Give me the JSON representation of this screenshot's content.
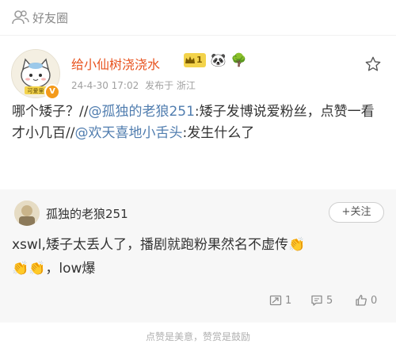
{
  "header": {
    "group_label": "好友圈",
    "group_icon": "group-icon"
  },
  "post": {
    "username": "给小仙树浇浇水",
    "level": "1",
    "badge_emojis": [
      "🐼",
      "🌳"
    ],
    "avatar_caption": "可爱里",
    "time": "24-4-30 17:02",
    "source": "发布于 浙江",
    "content": {
      "q": "哪个矮子？//",
      "mention1": "@孤独的老狼251",
      "mid": ":矮子发博说爱粉丝，点赞一看才小几百//",
      "mention2": "@欢天喜地小舌头",
      "end": ":发生什么了"
    }
  },
  "quote": {
    "username": "孤独的老狼251",
    "follow_label": "+关注",
    "text": "xswl,矮子太丢人了，播剧就跑粉果然名不虚传",
    "clap": "👏",
    "text_end": "low爆",
    "repost_count": "1",
    "comment_count": "5",
    "like_count": "0"
  },
  "footer": {
    "note": "点赞是美意，赞赏是鼓励"
  }
}
